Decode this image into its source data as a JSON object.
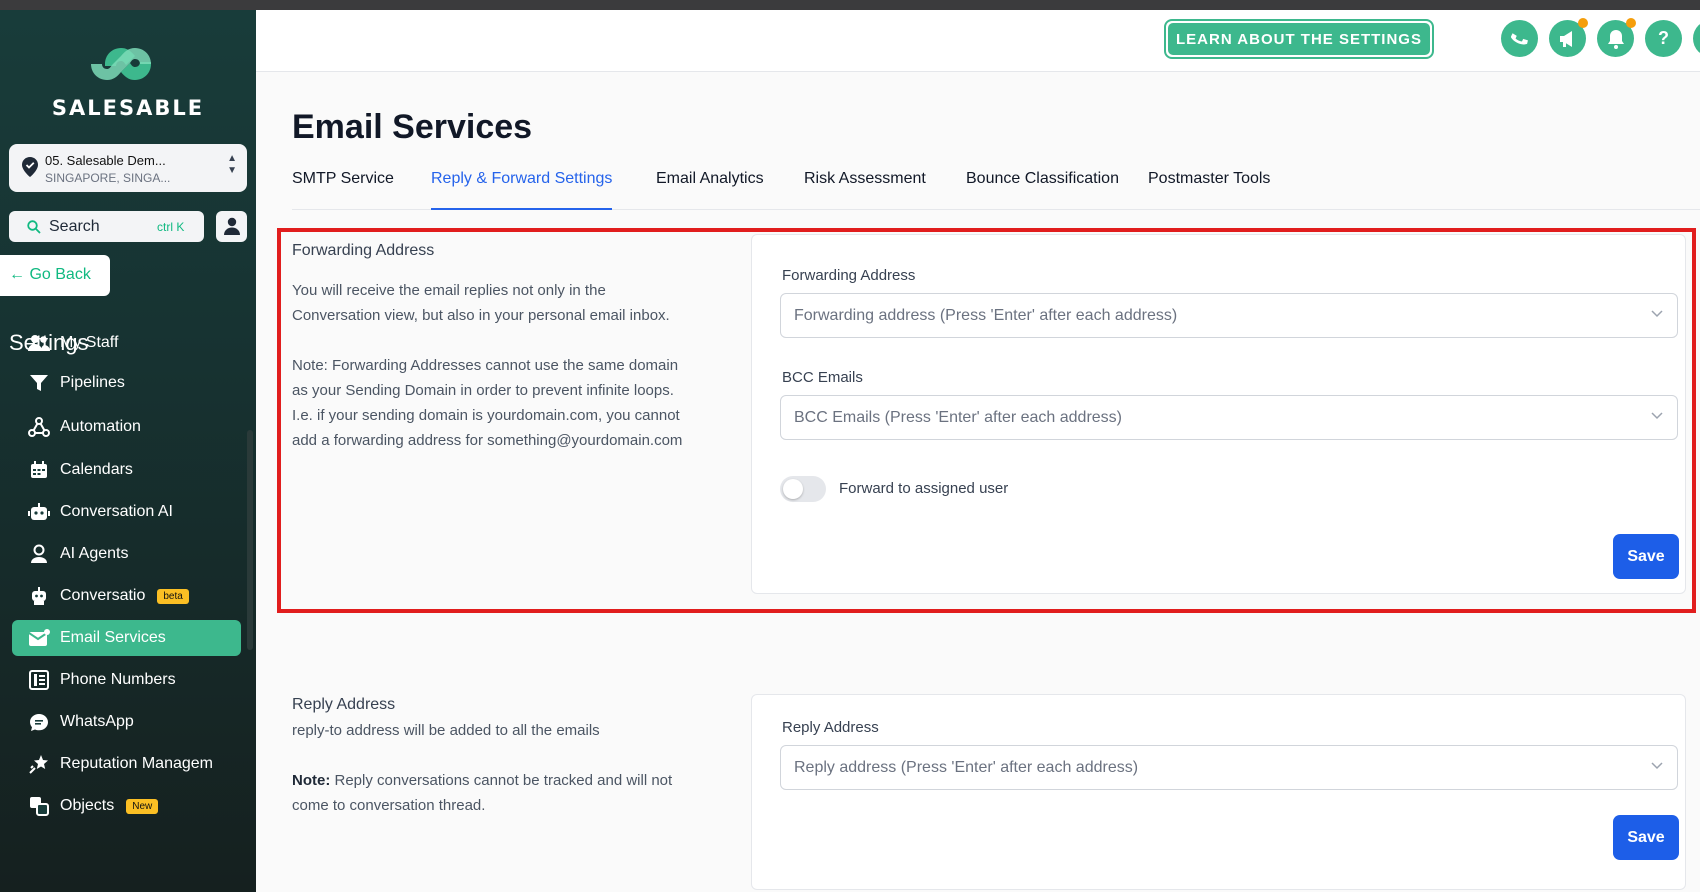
{
  "brand": {
    "name": "SALESABLE",
    "accent": "#3db88d",
    "sidebar_bg": "#183c3a",
    "primary_button": "#1d5ee8",
    "highlight_border": "#e11d1d"
  },
  "location": {
    "name": "05. Salesable Dem...",
    "sub": "SINGAPORE, SINGA..."
  },
  "search": {
    "label": "Search",
    "shortcut": "ctrl K"
  },
  "go_back": "Go Back",
  "sidebar": {
    "title": "Settings",
    "items": [
      {
        "label": "My Staff",
        "icon": "staff-icon"
      },
      {
        "label": "Pipelines",
        "icon": "funnel-icon"
      },
      {
        "label": "Automation",
        "icon": "automation-icon"
      },
      {
        "label": "Calendars",
        "icon": "calendar-icon"
      },
      {
        "label": "Conversation AI",
        "icon": "robot-icon"
      },
      {
        "label": "AI Agents",
        "icon": "agent-icon"
      },
      {
        "label": "Conversatio",
        "icon": "bot-icon",
        "badge": "beta"
      },
      {
        "label": "Email Services",
        "icon": "email-icon",
        "active": true
      },
      {
        "label": "Phone Numbers",
        "icon": "phone-book-icon"
      },
      {
        "label": "WhatsApp",
        "icon": "chat-icon"
      },
      {
        "label": "Reputation Managem",
        "icon": "star-icon"
      },
      {
        "label": "Objects",
        "icon": "objects-icon",
        "badge": "New"
      }
    ]
  },
  "header": {
    "learn_button": "LEARN ABOUT THE SETTINGS",
    "icons": [
      "phone-icon",
      "megaphone-icon",
      "bell-icon",
      "help-icon"
    ],
    "help_glyph": "?"
  },
  "page": {
    "title": "Email Services",
    "tabs": [
      {
        "label": "SMTP Service"
      },
      {
        "label": "Reply & Forward Settings",
        "active": true
      },
      {
        "label": "Email Analytics"
      },
      {
        "label": "Risk Assessment"
      },
      {
        "label": "Bounce Classification"
      },
      {
        "label": "Postmaster Tools"
      }
    ]
  },
  "forwarding": {
    "heading": "Forwarding Address",
    "desc_line1": "You will receive the email replies not only in the",
    "desc_line2": "Conversation view, but also in your personal email inbox.",
    "note_line1": "Note: Forwarding Addresses cannot use the same domain",
    "note_line2": "as your Sending Domain in order to prevent infinite loops.",
    "note_line3": "I.e. if your sending domain is yourdomain.com, you cannot",
    "note_line4": "add a forwarding address for something@yourdomain.com",
    "field_label": "Forwarding Address",
    "field_placeholder": "Forwarding address (Press 'Enter' after each address)",
    "bcc_label": "BCC Emails",
    "bcc_placeholder": "BCC Emails (Press 'Enter' after each address)",
    "toggle_label": "Forward to assigned user",
    "toggle_on": false,
    "save": "Save"
  },
  "reply": {
    "heading": "Reply Address",
    "desc": "reply-to address will be added to all the emails",
    "note_bold": "Note:",
    "note_rest": " Reply conversations cannot be tracked and will not",
    "note_line2": "come to conversation thread.",
    "field_label": "Reply Address",
    "field_placeholder": "Reply address (Press 'Enter' after each address)",
    "save": "Save"
  }
}
